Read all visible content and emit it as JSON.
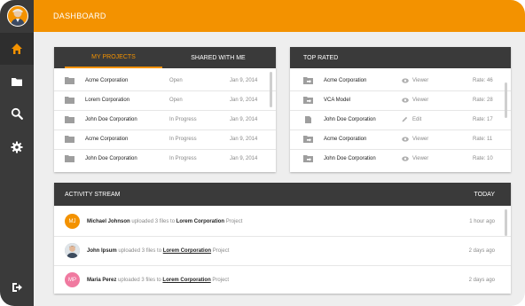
{
  "topbar": {
    "title": "DASHBOARD"
  },
  "colors": {
    "accent": "#f39200",
    "sidebar": "#3a3a3a"
  },
  "sidebar": {
    "items": [
      {
        "icon": "home-icon"
      },
      {
        "icon": "folder-icon"
      },
      {
        "icon": "search-icon"
      },
      {
        "icon": "gear-icon"
      },
      {
        "icon": "logout-icon"
      }
    ]
  },
  "projects": {
    "tabs": [
      "MY PROJECTS",
      "SHARED WITH ME"
    ],
    "rows": [
      {
        "name": "Acme Corporation",
        "status": "Open",
        "date": "Jan 9, 2014"
      },
      {
        "name": "Lorem Corporation",
        "status": "Open",
        "date": "Jan 9, 2014"
      },
      {
        "name": "John Doe Corporation",
        "status": "In Progress",
        "date": "Jan 9, 2014"
      },
      {
        "name": "Acme Corporation",
        "status": "In Progress",
        "date": "Jan 9, 2014"
      },
      {
        "name": "John Doe Corporation",
        "status": "In Progress",
        "date": "Jan 9, 2014"
      }
    ]
  },
  "top_rated": {
    "title": "TOP RATED",
    "rows": [
      {
        "name": "Acme Corporation",
        "role": "Viewer",
        "rate": "Rate: 46"
      },
      {
        "name": "VCA Model",
        "role": "Viewer",
        "rate": "Rate: 28"
      },
      {
        "name": "John Doe Corporation",
        "role": "Edit",
        "rate": "Rate: 17"
      },
      {
        "name": "Acme Corporation",
        "role": "Viewer",
        "rate": "Rate: 11"
      },
      {
        "name": "John Doe Corporation",
        "role": "Viewer",
        "rate": "Rate: 10"
      }
    ]
  },
  "activity": {
    "title": "ACTIVITY STREAM",
    "filter": "TODAY",
    "items": [
      {
        "initials": "MJ",
        "avatar_color": "#f39200",
        "user": "Michael Johnson",
        "action": "uploaded 3 files to",
        "target": "Lorem Corporation",
        "suffix": "Project",
        "time": "1 hour ago"
      },
      {
        "initials": "",
        "avatar_color": "#9aa9b5",
        "user": "John Ipsum",
        "action": "uploaded 3 files to",
        "target": "Lorem Corporation",
        "suffix": "Project",
        "time": "2 days ago"
      },
      {
        "initials": "MP",
        "avatar_color": "#f07aa0",
        "user": "Maria Perez",
        "action": "uploaded 3 files to",
        "target": "Lorem Corporation",
        "suffix": "Project",
        "time": "2 days ago"
      }
    ]
  }
}
